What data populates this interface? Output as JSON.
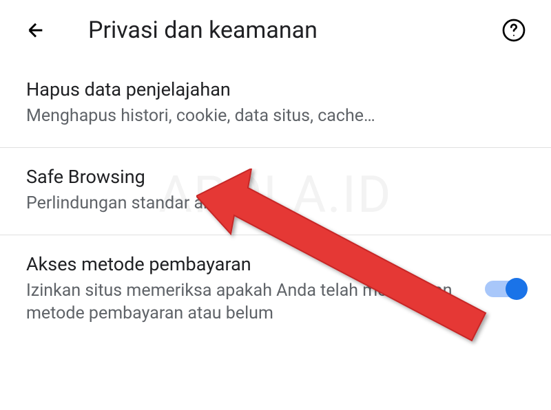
{
  "header": {
    "title": "Privasi dan keamanan"
  },
  "watermark": "APOLA.ID",
  "items": [
    {
      "title": "Hapus data penjelajahan",
      "subtitle": "Menghapus histori, cookie, data situs, cache…"
    },
    {
      "title": "Safe Browsing",
      "subtitle": "Perlindungan standar aktif"
    },
    {
      "title": "Akses metode pembayaran",
      "subtitle": "Izinkan situs memeriksa apakah Anda telah menyimpan metode pembayaran atau belum",
      "toggle_on": true
    }
  ]
}
